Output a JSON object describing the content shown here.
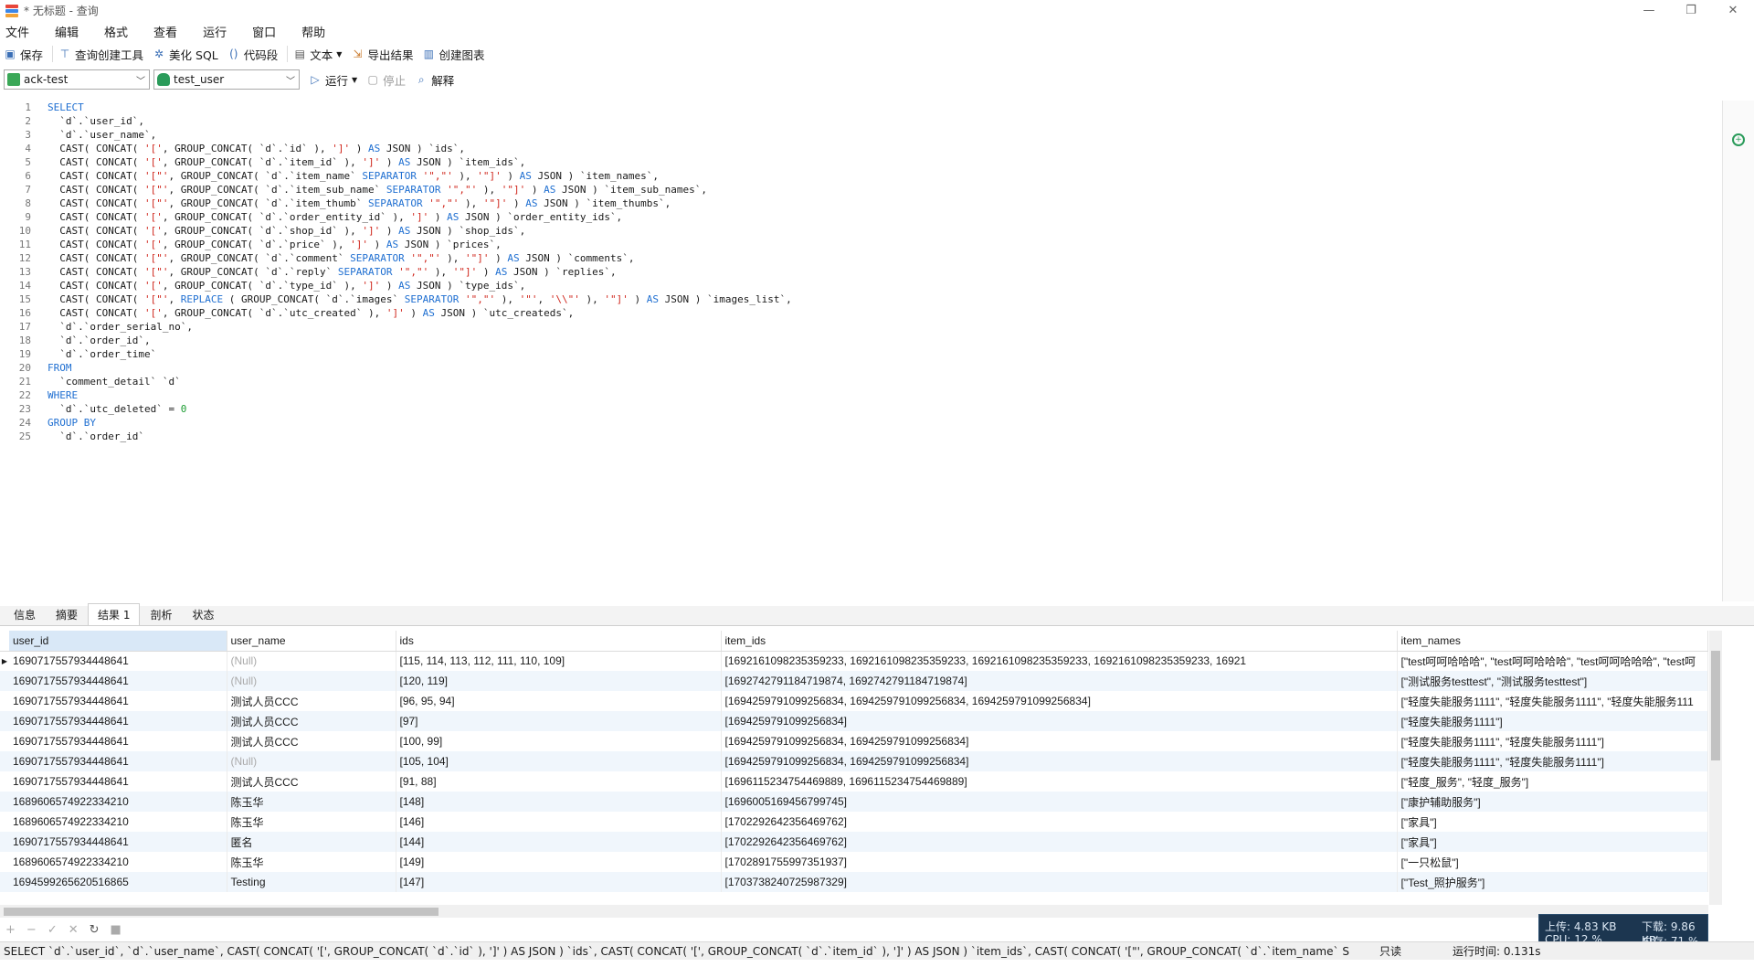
{
  "window": {
    "title": "* 无标题 - 查询",
    "controls": [
      "—",
      "❐",
      "✕"
    ]
  },
  "menu": [
    "文件",
    "编辑",
    "格式",
    "查看",
    "运行",
    "窗口",
    "帮助"
  ],
  "toolbar": {
    "save": "保存",
    "query_builder": "查询创建工具",
    "beautify": "美化 SQL",
    "snippet": "代码段",
    "text": "文本",
    "export": "导出结果",
    "chart": "创建图表"
  },
  "connbar": {
    "connection": "ack-test",
    "database": "test_user",
    "run": "运行",
    "stop": "停止",
    "explain": "解释"
  },
  "sql_lines": [
    [
      [
        "kw",
        "SELECT"
      ]
    ],
    [
      [
        "t",
        "  `d`.`user_id`,"
      ]
    ],
    [
      [
        "t",
        "  `d`.`user_name`,"
      ]
    ],
    [
      [
        "t",
        "  CAST( CONCAT( "
      ],
      [
        "str",
        "'['"
      ],
      [
        "t",
        ", GROUP_CONCAT( `d`.`id` ), "
      ],
      [
        "str",
        "']'"
      ],
      [
        "t",
        " ) "
      ],
      [
        "kw",
        "AS"
      ],
      [
        "t",
        " JSON ) `ids`,"
      ]
    ],
    [
      [
        "t",
        "  CAST( CONCAT( "
      ],
      [
        "str",
        "'['"
      ],
      [
        "t",
        ", GROUP_CONCAT( `d`.`item_id` ), "
      ],
      [
        "str",
        "']'"
      ],
      [
        "t",
        " ) "
      ],
      [
        "kw",
        "AS"
      ],
      [
        "t",
        " JSON ) `item_ids`,"
      ]
    ],
    [
      [
        "t",
        "  CAST( CONCAT( "
      ],
      [
        "str",
        "'[\"'"
      ],
      [
        "t",
        ", GROUP_CONCAT( `d`.`item_name` "
      ],
      [
        "kw",
        "SEPARATOR"
      ],
      [
        "t",
        " "
      ],
      [
        "str",
        "'\",\"'"
      ],
      [
        "t",
        " ), "
      ],
      [
        "str",
        "'\"]'"
      ],
      [
        "t",
        " ) "
      ],
      [
        "kw",
        "AS"
      ],
      [
        "t",
        " JSON ) `item_names`,"
      ]
    ],
    [
      [
        "t",
        "  CAST( CONCAT( "
      ],
      [
        "str",
        "'[\"'"
      ],
      [
        "t",
        ", GROUP_CONCAT( `d`.`item_sub_name` "
      ],
      [
        "kw",
        "SEPARATOR"
      ],
      [
        "t",
        " "
      ],
      [
        "str",
        "'\",\"'"
      ],
      [
        "t",
        " ), "
      ],
      [
        "str",
        "'\"]'"
      ],
      [
        "t",
        " ) "
      ],
      [
        "kw",
        "AS"
      ],
      [
        "t",
        " JSON ) `item_sub_names`,"
      ]
    ],
    [
      [
        "t",
        "  CAST( CONCAT( "
      ],
      [
        "str",
        "'[\"'"
      ],
      [
        "t",
        ", GROUP_CONCAT( `d`.`item_thumb` "
      ],
      [
        "kw",
        "SEPARATOR"
      ],
      [
        "t",
        " "
      ],
      [
        "str",
        "'\",\"'"
      ],
      [
        "t",
        " ), "
      ],
      [
        "str",
        "'\"]'"
      ],
      [
        "t",
        " ) "
      ],
      [
        "kw",
        "AS"
      ],
      [
        "t",
        " JSON ) `item_thumbs`,"
      ]
    ],
    [
      [
        "t",
        "  CAST( CONCAT( "
      ],
      [
        "str",
        "'['"
      ],
      [
        "t",
        ", GROUP_CONCAT( `d`.`order_entity_id` ), "
      ],
      [
        "str",
        "']'"
      ],
      [
        "t",
        " ) "
      ],
      [
        "kw",
        "AS"
      ],
      [
        "t",
        " JSON ) `order_entity_ids`,"
      ]
    ],
    [
      [
        "t",
        "  CAST( CONCAT( "
      ],
      [
        "str",
        "'['"
      ],
      [
        "t",
        ", GROUP_CONCAT( `d`.`shop_id` ), "
      ],
      [
        "str",
        "']'"
      ],
      [
        "t",
        " ) "
      ],
      [
        "kw",
        "AS"
      ],
      [
        "t",
        " JSON ) `shop_ids`,"
      ]
    ],
    [
      [
        "t",
        "  CAST( CONCAT( "
      ],
      [
        "str",
        "'['"
      ],
      [
        "t",
        ", GROUP_CONCAT( `d`.`price` ), "
      ],
      [
        "str",
        "']'"
      ],
      [
        "t",
        " ) "
      ],
      [
        "kw",
        "AS"
      ],
      [
        "t",
        " JSON ) `prices`,"
      ]
    ],
    [
      [
        "t",
        "  CAST( CONCAT( "
      ],
      [
        "str",
        "'[\"'"
      ],
      [
        "t",
        ", GROUP_CONCAT( `d`.`comment` "
      ],
      [
        "kw",
        "SEPARATOR"
      ],
      [
        "t",
        " "
      ],
      [
        "str",
        "'\",\"'"
      ],
      [
        "t",
        " ), "
      ],
      [
        "str",
        "'\"]'"
      ],
      [
        "t",
        " ) "
      ],
      [
        "kw",
        "AS"
      ],
      [
        "t",
        " JSON ) `comments`,"
      ]
    ],
    [
      [
        "t",
        "  CAST( CONCAT( "
      ],
      [
        "str",
        "'[\"'"
      ],
      [
        "t",
        ", GROUP_CONCAT( `d`.`reply` "
      ],
      [
        "kw",
        "SEPARATOR"
      ],
      [
        "t",
        " "
      ],
      [
        "str",
        "'\",\"'"
      ],
      [
        "t",
        " ), "
      ],
      [
        "str",
        "'\"]'"
      ],
      [
        "t",
        " ) "
      ],
      [
        "kw",
        "AS"
      ],
      [
        "t",
        " JSON ) `replies`,"
      ]
    ],
    [
      [
        "t",
        "  CAST( CONCAT( "
      ],
      [
        "str",
        "'['"
      ],
      [
        "t",
        ", GROUP_CONCAT( `d`.`type_id` ), "
      ],
      [
        "str",
        "']'"
      ],
      [
        "t",
        " ) "
      ],
      [
        "kw",
        "AS"
      ],
      [
        "t",
        " JSON ) `type_ids`,"
      ]
    ],
    [
      [
        "t",
        "  CAST( CONCAT( "
      ],
      [
        "str",
        "'[\"'"
      ],
      [
        "t",
        ", "
      ],
      [
        "kw",
        "REPLACE"
      ],
      [
        "t",
        " ( GROUP_CONCAT( `d`.`images` "
      ],
      [
        "kw",
        "SEPARATOR"
      ],
      [
        "t",
        " "
      ],
      [
        "str",
        "'\",\"'"
      ],
      [
        "t",
        " ), "
      ],
      [
        "str",
        "'\"'"
      ],
      [
        "t",
        ", "
      ],
      [
        "str",
        "'\\\\\"'"
      ],
      [
        "t",
        " ), "
      ],
      [
        "str",
        "'\"]'"
      ],
      [
        "t",
        " ) "
      ],
      [
        "kw",
        "AS"
      ],
      [
        "t",
        " JSON ) `images_list`,"
      ]
    ],
    [
      [
        "t",
        "  CAST( CONCAT( "
      ],
      [
        "str",
        "'['"
      ],
      [
        "t",
        ", GROUP_CONCAT( `d`.`utc_created` ), "
      ],
      [
        "str",
        "']'"
      ],
      [
        "t",
        " ) "
      ],
      [
        "kw",
        "AS"
      ],
      [
        "t",
        " JSON ) `utc_createds`,"
      ]
    ],
    [
      [
        "t",
        "  `d`.`order_serial_no`,"
      ]
    ],
    [
      [
        "t",
        "  `d`.`order_id`,"
      ]
    ],
    [
      [
        "t",
        "  `d`.`order_time`"
      ]
    ],
    [
      [
        "kw",
        "FROM"
      ]
    ],
    [
      [
        "t",
        "  `comment_detail` `d`"
      ]
    ],
    [
      [
        "kw",
        "WHERE"
      ]
    ],
    [
      [
        "t",
        "  `d`.`utc_deleted` = "
      ],
      [
        "num",
        "0"
      ]
    ],
    [
      [
        "kw",
        "GROUP BY"
      ]
    ],
    [
      [
        "t",
        "  `d`.`order_id`"
      ]
    ]
  ],
  "result_tabs": [
    "信息",
    "摘要",
    "结果 1",
    "剖析",
    "状态"
  ],
  "grid": {
    "columns": [
      "user_id",
      "user_name",
      "ids",
      "item_ids",
      "item_names"
    ],
    "rows": [
      [
        "1690717557934448641",
        "(Null)",
        "[115, 114, 113, 112, 111, 110, 109]",
        "[1692161098235359233, 1692161098235359233, 1692161098235359233, 1692161098235359233, 16921",
        "[\"test呵呵哈哈哈\", \"test呵呵哈哈哈\", \"test呵呵哈哈哈\", \"test呵"
      ],
      [
        "1690717557934448641",
        "(Null)",
        "[120, 119]",
        "[1692742791184719874, 1692742791184719874]",
        "[\"测试服务testtest\", \"测试服务testtest\"]"
      ],
      [
        "1690717557934448641",
        "测试人员CCC",
        "[96, 95, 94]",
        "[1694259791099256834, 1694259791099256834, 1694259791099256834]",
        "[\"轻度失能服务1111\", \"轻度失能服务1111\", \"轻度失能服务111"
      ],
      [
        "1690717557934448641",
        "测试人员CCC",
        "[97]",
        "[1694259791099256834]",
        "[\"轻度失能服务1111\"]"
      ],
      [
        "1690717557934448641",
        "测试人员CCC",
        "[100, 99]",
        "[1694259791099256834, 1694259791099256834]",
        "[\"轻度失能服务1111\", \"轻度失能服务1111\"]"
      ],
      [
        "1690717557934448641",
        "(Null)",
        "[105, 104]",
        "[1694259791099256834, 1694259791099256834]",
        "[\"轻度失能服务1111\", \"轻度失能服务1111\"]"
      ],
      [
        "1690717557934448641",
        "测试人员CCC",
        "[91, 88]",
        "[1696115234754469889, 1696115234754469889]",
        "[\"轻度_服务\", \"轻度_服务\"]"
      ],
      [
        "1689606574922334210",
        "陈玉华",
        "[148]",
        "[1696005169456799745]",
        "[\"康护辅助服务\"]"
      ],
      [
        "1689606574922334210",
        "陈玉华",
        "[146]",
        "[1702292642356469762]",
        "[\"家具\"]"
      ],
      [
        "1690717557934448641",
        "匿名",
        "[144]",
        "[1702292642356469762]",
        "[\"家具\"]"
      ],
      [
        "1689606574922334210",
        "陈玉华",
        "[149]",
        "[1702891755997351937]",
        "[\"一只松鼠\"]"
      ],
      [
        "1694599265620516865",
        "Testing",
        "[147]",
        "[1703738240725987329]",
        "[\"Test_照护服务\"]"
      ]
    ]
  },
  "statusbar": {
    "query": "SELECT   `d`.`user_id`,    `d`.`user_name`,    CAST( CONCAT( '[', GROUP_CONCAT( `d`.`id` ), ']' ) AS JSON ) `ids`,  CAST( CONCAT( '[', GROUP_CONCAT( `d`.`item_id` ), ']' ) AS JSON ) `item_ids`,       CAST( CONCAT( '[\"', GROUP_CONCAT( `d`.`item_name` S",
    "readonly": "只读",
    "runtime": "运行时间: 0.131s"
  },
  "netwidget": {
    "upload": "上传: 4.83 KB",
    "download": "下载: 9.86 KB",
    "cpu": "CPU: 12 %",
    "mem": "内存: 71 %"
  },
  "colors": {
    "keyword": "#1f6fd1",
    "string": "#d0271d",
    "number": "#1a9c30",
    "selected_header": "#d9e8f7",
    "alt_row": "#f0f6fc"
  }
}
